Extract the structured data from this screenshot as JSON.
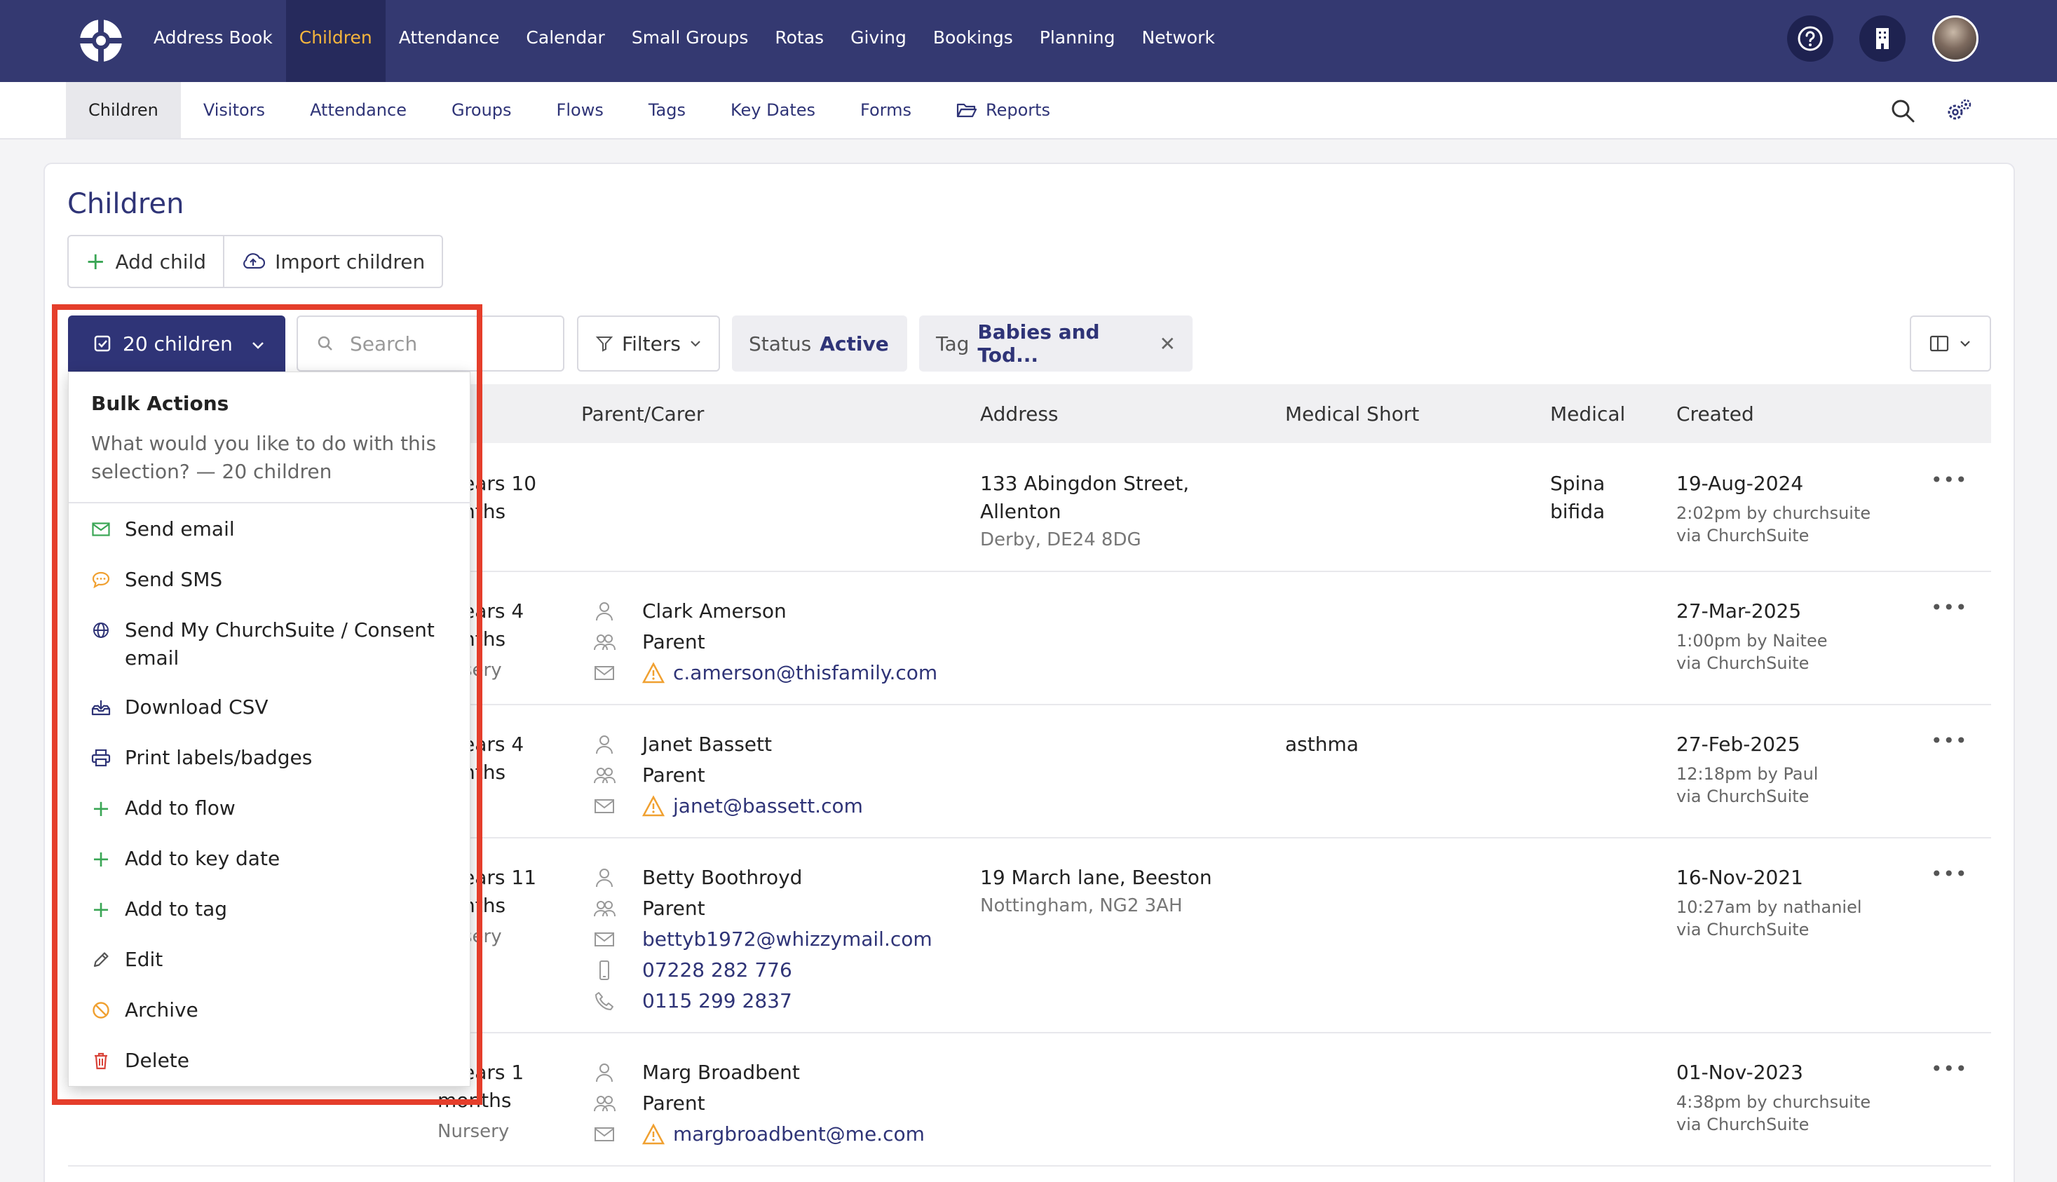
{
  "topnav": {
    "items": [
      "Address Book",
      "Children",
      "Attendance",
      "Calendar",
      "Small Groups",
      "Rotas",
      "Giving",
      "Bookings",
      "Planning",
      "Network"
    ]
  },
  "subnav": {
    "items": [
      "Children",
      "Visitors",
      "Attendance",
      "Groups",
      "Flows",
      "Tags",
      "Key Dates",
      "Forms",
      "Reports"
    ]
  },
  "page": {
    "title": "Children",
    "add_child": "Add child",
    "import_children": "Import children"
  },
  "toolbar": {
    "selection": "20 children",
    "search_placeholder": "Search",
    "filters": "Filters",
    "status_label": "Status",
    "status_value": "Active",
    "tag_label": "Tag",
    "tag_value": "Babies and Tod..."
  },
  "table": {
    "headers": [
      "Parent/Carer",
      "Address",
      "Medical Short",
      "Medical",
      "Created"
    ],
    "rows": [
      {
        "age1": "ears 10",
        "age2": "nths",
        "age3": "",
        "parent_name": "",
        "parent_role": "",
        "email": "",
        "phone1": "",
        "phone2": "",
        "addr1": "133 Abingdon Street,",
        "addr2": "Allenton",
        "addr3": "Derby, DE24 8DG",
        "med_short": "",
        "medical1": "Spina",
        "medical2": "bifida",
        "created": "19-Aug-2024",
        "created_by": "2:02pm by churchsuite",
        "created_via": "via ChurchSuite"
      },
      {
        "age1": "ears 4",
        "age2": "nths",
        "age3": "sery",
        "parent_name": "Clark Amerson",
        "parent_role": "Parent",
        "email": "c.amerson@thisfamily.com",
        "phone1": "",
        "phone2": "",
        "addr1": "",
        "addr2": "",
        "addr3": "",
        "med_short": "",
        "medical1": "",
        "medical2": "",
        "created": "27-Mar-2025",
        "created_by": "1:00pm by Naitee",
        "created_via": "via ChurchSuite"
      },
      {
        "age1": "ears 4",
        "age2": "nths",
        "age3": "",
        "parent_name": "Janet Bassett",
        "parent_role": "Parent",
        "email": "janet@bassett.com",
        "phone1": "",
        "phone2": "",
        "addr1": "",
        "addr2": "",
        "addr3": "",
        "med_short": "asthma",
        "medical1": "",
        "medical2": "",
        "created": "27-Feb-2025",
        "created_by": "12:18pm by Paul",
        "created_via": "via ChurchSuite"
      },
      {
        "age1": "ears 11",
        "age2": "nths",
        "age3": "sery",
        "parent_name": "Betty Boothroyd",
        "parent_role": "Parent",
        "email": "bettyb1972@whizzymail.com",
        "phone1": "07228 282 776",
        "phone2": "0115 299 2837",
        "addr1": "19 March lane, Beeston",
        "addr2": "Nottingham, NG2 3AH",
        "addr3": "",
        "med_short": "",
        "medical1": "",
        "medical2": "",
        "created": "16-Nov-2021",
        "created_by": "10:27am by nathaniel",
        "created_via": "via ChurchSuite"
      },
      {
        "age1": "ears 1",
        "age2": "months",
        "age3": "Nursery",
        "parent_name": "Marg Broadbent",
        "parent_role": "Parent",
        "email": "margbroadbent@me.com",
        "phone1": "",
        "phone2": "",
        "addr1": "",
        "addr2": "",
        "addr3": "",
        "med_short": "",
        "medical1": "",
        "medical2": "",
        "created": "01-Nov-2023",
        "created_by": "4:38pm by churchsuite",
        "created_via": "via ChurchSuite"
      }
    ]
  },
  "bulk": {
    "title": "Bulk Actions",
    "description": "What would you like to do with this selection? — 20 children",
    "items": [
      {
        "label": "Send email",
        "icon": "envelope-icon",
        "color": "#3aa655"
      },
      {
        "label": "Send SMS",
        "icon": "chat-bubble-icon",
        "color": "#f0a030"
      },
      {
        "label": "Send My ChurchSuite / Consent email",
        "icon": "globe-icon",
        "color": "#2f3477"
      },
      {
        "label": "Download CSV",
        "icon": "download-tray-icon",
        "color": "#2f3477"
      },
      {
        "label": "Print labels/badges",
        "icon": "printer-icon",
        "color": "#2f3477"
      },
      {
        "label": "Add to flow",
        "icon": "plus-icon",
        "color": "#3aa655"
      },
      {
        "label": "Add to key date",
        "icon": "plus-icon",
        "color": "#3aa655"
      },
      {
        "label": "Add to tag",
        "icon": "plus-icon",
        "color": "#3aa655"
      },
      {
        "label": "Edit",
        "icon": "pencil-icon",
        "color": "#555555"
      },
      {
        "label": "Archive",
        "icon": "ban-icon",
        "color": "#f0a030"
      },
      {
        "label": "Delete",
        "icon": "trash-icon",
        "color": "#d9443a"
      }
    ]
  },
  "colors": {
    "brand": "#343971",
    "accent": "#f5b53d",
    "highlight": "#e53e2b"
  }
}
